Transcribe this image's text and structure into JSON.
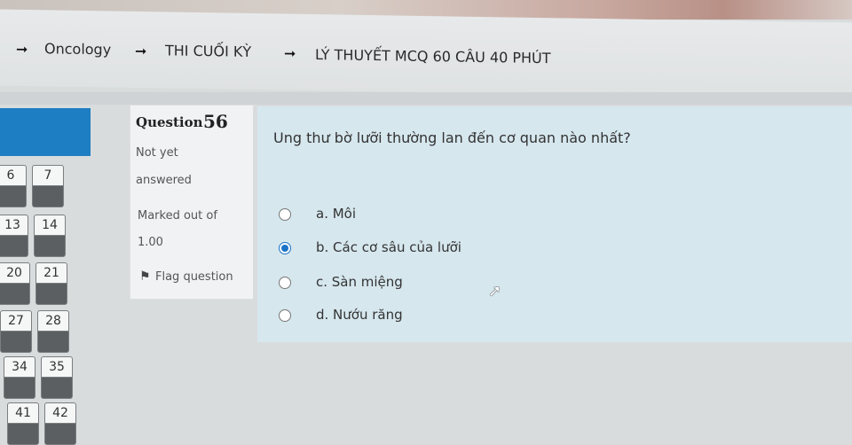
{
  "breadcrumb": {
    "items": [
      "Oncology",
      "THI CUỐI KỲ",
      "LÝ THUYẾT MCQ 60 CÂU 40 PHÚT"
    ]
  },
  "navigation": {
    "question_numbers": [
      "6",
      "7",
      "13",
      "14",
      "20",
      "21",
      "27",
      "28",
      "34",
      "35",
      "41",
      "42"
    ]
  },
  "question_info": {
    "label": "Question",
    "number": "56",
    "state_line1": "Not yet",
    "state_line2": "answered",
    "marked": "Marked out of",
    "grade": "1.00",
    "flag": "Flag question"
  },
  "question": {
    "text": "Ung thư bờ lưỡi thường lan đến cơ quan nào nhất?",
    "answers": [
      {
        "label": "a. Môi",
        "selected": false
      },
      {
        "label": "b. Các cơ sâu của lưỡi",
        "selected": true
      },
      {
        "label": "c. Sàn miệng",
        "selected": false
      },
      {
        "label": "d. Nướu răng",
        "selected": false
      }
    ]
  },
  "colors": {
    "accent": "#1d7ec3",
    "panel": "#d6e7ee",
    "radio_selected": "#1a73c8"
  },
  "icons": {
    "breadcrumb_separator": "arrow-right-icon",
    "flag": "flag-icon",
    "cursor": "mouse-pointer-icon"
  }
}
